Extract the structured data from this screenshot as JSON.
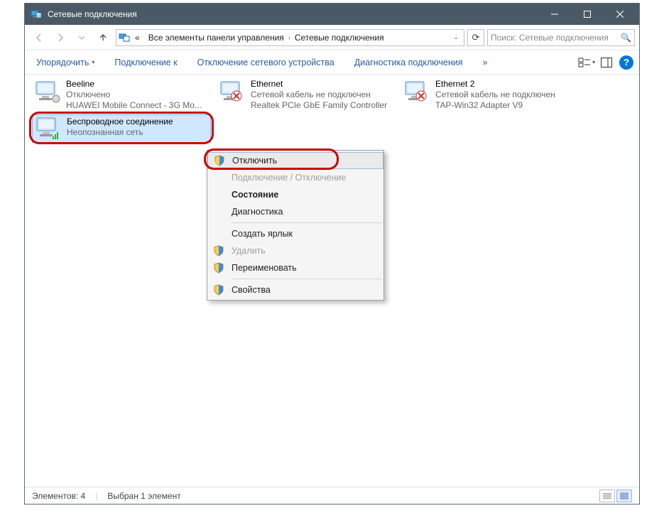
{
  "titlebar": {
    "title": "Сетевые подключения"
  },
  "address": {
    "prefix": "«",
    "seg1": "Все элементы панели управления",
    "seg2": "Сетевые подключения"
  },
  "search": {
    "placeholder": "Поиск: Сетевые подключения"
  },
  "cmd": {
    "organize": "Упорядочить",
    "connect_to": "Подключение к",
    "disable_device": "Отключение сетевого устройства",
    "diagnostics": "Диагностика подключения",
    "more": "»"
  },
  "items": [
    {
      "title": "Beeline",
      "sub1": "Отключено",
      "sub2": "HUAWEI Mobile Connect - 3G Mo..."
    },
    {
      "title": "Ethernet",
      "sub1": "Сетевой кабель не подключен",
      "sub2": "Realtek PCIe GbE Family Controller"
    },
    {
      "title": "Ethernet 2",
      "sub1": "Сетевой кабель не подключен",
      "sub2": "TAP-Win32 Adapter V9"
    },
    {
      "title": "Беспроводное соединение",
      "sub1": "Неопознанная сеть",
      "sub2": ""
    }
  ],
  "ctx": {
    "disable": "Отключить",
    "toggle": "Подключение / Отключение",
    "status": "Состояние",
    "diag": "Диагностика",
    "shortcut": "Создать ярлык",
    "delete": "Удалить",
    "rename": "Переименовать",
    "props": "Свойства"
  },
  "status": {
    "count": "Элементов: 4",
    "selected": "Выбран 1 элемент"
  }
}
